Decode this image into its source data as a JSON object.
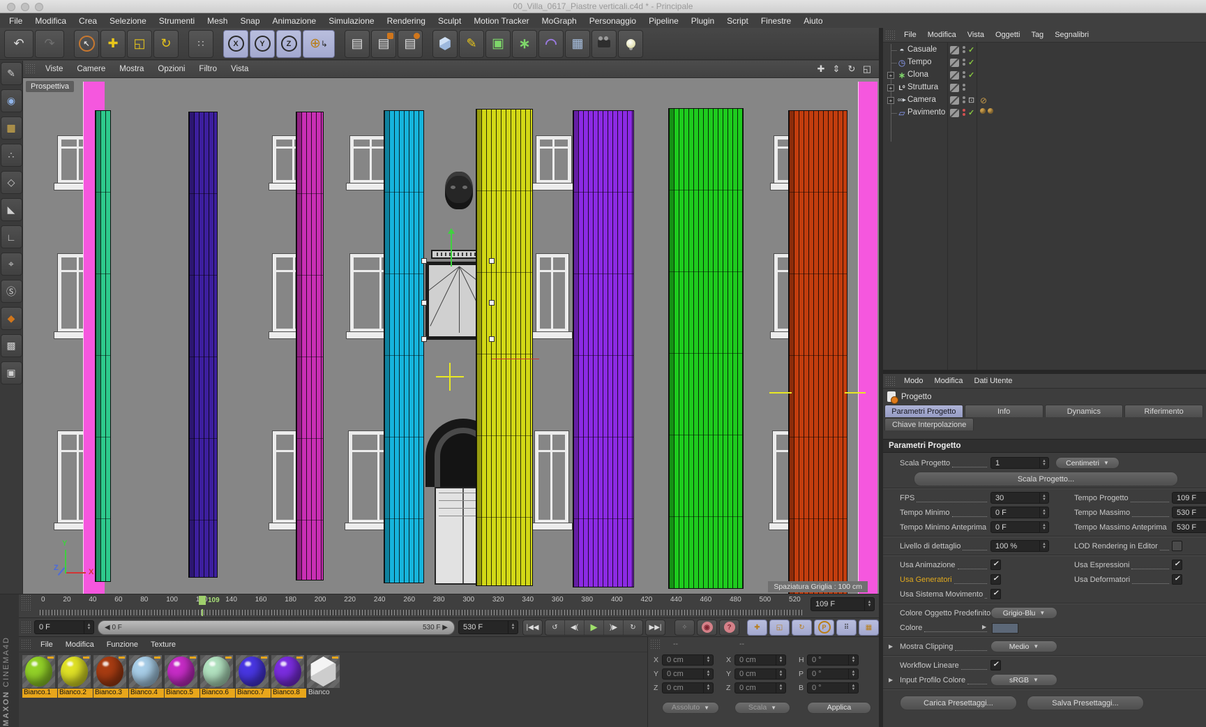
{
  "window": {
    "title": "00_Villa_0617_Piastre verticali.c4d * - Principale"
  },
  "main_menu": [
    "File",
    "Modifica",
    "Crea",
    "Selezione",
    "Strumenti",
    "Mesh",
    "Snap",
    "Animazione",
    "Simulazione",
    "Rendering",
    "Sculpt",
    "Motion Tracker",
    "MoGraph",
    "Personaggio",
    "Pipeline",
    "Plugin",
    "Script",
    "Finestre",
    "Aiuto"
  ],
  "viewport": {
    "menu": [
      "Viste",
      "Camere",
      "Mostra",
      "Opzioni",
      "Filtro",
      "Vista"
    ],
    "view_label": "Prospettiva",
    "grid_status": "Spaziatura Griglia : 100 cm",
    "axis_labels": {
      "x": "X",
      "y": "Y",
      "z": "Z"
    },
    "pink": "#f557de",
    "slabs": [
      {
        "name": "slab-teal",
        "color": "#2ec98c"
      },
      {
        "name": "slab-indigo",
        "color": "#3d1f9e"
      },
      {
        "name": "slab-magenta",
        "color": "#c92fb4"
      },
      {
        "name": "slab-cyan",
        "color": "#16b4dc"
      },
      {
        "name": "slab-yellow",
        "color": "#d2d816"
      },
      {
        "name": "slab-violet",
        "color": "#8c2ae4"
      },
      {
        "name": "slab-green",
        "color": "#1ecb1e"
      },
      {
        "name": "slab-rust",
        "color": "#c23d0e"
      }
    ]
  },
  "object_manager": {
    "menu": [
      "File",
      "Modifica",
      "Vista",
      "Oggetti",
      "Tag",
      "Segnalibri"
    ],
    "objects": [
      {
        "name": "Casuale"
      },
      {
        "name": "Tempo"
      },
      {
        "name": "Clona"
      },
      {
        "name": "Struttura"
      },
      {
        "name": "Camera"
      },
      {
        "name": "Pavimento"
      }
    ]
  },
  "attributes": {
    "menu": [
      "Modo",
      "Modifica",
      "Dati Utente"
    ],
    "object_label": "Progetto",
    "tabs": [
      "Parametri Progetto",
      "Info",
      "Dynamics",
      "Riferimento"
    ],
    "tab_row2": "Chiave Interpolazione",
    "section": "Parametri Progetto",
    "scala": {
      "label": "Scala Progetto",
      "value": "1",
      "unit": "Centimetri",
      "button": "Scala Progetto..."
    },
    "time_rows": [
      {
        "l": "FPS",
        "lv": "30",
        "r": "Tempo Progetto",
        "rv": "109 F"
      },
      {
        "l": "Tempo Minimo",
        "lv": "0 F",
        "r": "Tempo Massimo",
        "rv": "530 F"
      },
      {
        "l": "Tempo Minimo Anteprima",
        "lv": "0 F",
        "r": "Tempo Massimo Anteprima",
        "rv": "530 F"
      }
    ],
    "lod": {
      "label": "Livello di dettaglio",
      "value": "100 %",
      "right_label": "LOD Rendering in Editor"
    },
    "toggles": [
      {
        "l": "Usa Animazione",
        "r": "Usa Espressioni"
      },
      {
        "l": "Usa Generatori",
        "r": "Usa Deformatori"
      },
      {
        "l": "Usa Sistema Movimento",
        "r": ""
      }
    ],
    "color_default": {
      "label": "Colore Oggetto Predefinito",
      "value": "Grigio-Blu"
    },
    "color_row": {
      "label": "Colore",
      "swatch": "#5c6878"
    },
    "clipping": {
      "label": "Mostra Clipping",
      "value": "Medio"
    },
    "workflow": {
      "label": "Workflow Lineare"
    },
    "profile": {
      "label": "Input Profilo Colore",
      "value": "sRGB"
    },
    "preset_load": "Carica Presettaggi...",
    "preset_save": "Salva Presettaggi..."
  },
  "timeline": {
    "ticks": [
      "0",
      "20",
      "40",
      "60",
      "80",
      "100",
      "120",
      "140",
      "160",
      "180",
      "200",
      "220",
      "240",
      "260",
      "280",
      "300",
      "320",
      "340",
      "360",
      "380",
      "400",
      "420",
      "440",
      "460",
      "480",
      "500",
      "520"
    ],
    "playhead": "109",
    "frame_field": "109 F"
  },
  "transport": {
    "current": "0 F",
    "range_start": "0 F",
    "range_end": "530 F",
    "end_field": "530 F"
  },
  "materials": {
    "menu": [
      "File",
      "Modifica",
      "Funzione",
      "Texture"
    ],
    "items": [
      {
        "name": "Bianco.1",
        "color": "#93d228",
        "selected": true,
        "shape": "sphere"
      },
      {
        "name": "Bianco.2",
        "color": "#e0e226",
        "selected": true,
        "shape": "sphere"
      },
      {
        "name": "Bianco.3",
        "color": "#a83c12",
        "selected": true,
        "shape": "sphere"
      },
      {
        "name": "Bianco.4",
        "color": "#a8cee8",
        "selected": true,
        "shape": "sphere"
      },
      {
        "name": "Bianco.5",
        "color": "#c72cc7",
        "selected": true,
        "shape": "sphere"
      },
      {
        "name": "Bianco.6",
        "color": "#b2e2c0",
        "selected": true,
        "shape": "sphere"
      },
      {
        "name": "Bianco.7",
        "color": "#4836e2",
        "selected": true,
        "shape": "sphere"
      },
      {
        "name": "Bianco.8",
        "color": "#7b2de0",
        "selected": true,
        "shape": "sphere"
      },
      {
        "name": "Bianco",
        "color": "#e9e9e9",
        "selected": false,
        "shape": "cube"
      }
    ]
  },
  "coordinates": {
    "header": [
      "--",
      "--"
    ],
    "pos": {
      "labels": [
        "X",
        "Y",
        "Z"
      ],
      "values": [
        "0 cm",
        "0 cm",
        "0 cm"
      ]
    },
    "size": {
      "labels": [
        "X",
        "Y",
        "Z"
      ],
      "values": [
        "0 cm",
        "0 cm",
        "0 cm"
      ]
    },
    "rot": {
      "labels": [
        "H",
        "P",
        "B"
      ],
      "values": [
        "0 °",
        "0 °",
        "0 °"
      ]
    },
    "mode": "Assoluto",
    "mode2": "Scala",
    "apply": "Applica"
  },
  "branding": {
    "line1": "MAXON",
    "line2": "CINEMA4D"
  }
}
